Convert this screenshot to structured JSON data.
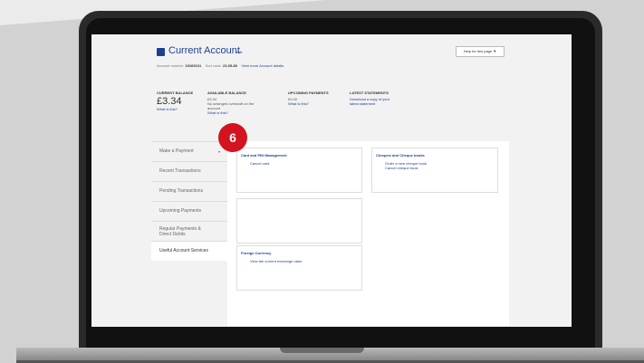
{
  "account": {
    "title": "Current Account",
    "edit_label": "edit",
    "help_label": "Help for this page ▼",
    "number_label": "Account number:",
    "number_value": "15169101",
    "sort_label": "Sort code:",
    "sort_value": "23-05-80",
    "details_link": "View more Account details"
  },
  "summary": {
    "current_balance": {
      "heading": "CURRENT BALANCE",
      "value": "£3.34",
      "link": "What is this?"
    },
    "available_balance": {
      "heading": "AVAILABLE BALANCE",
      "value": "£3.34",
      "line1": "No arranged overdraft on the",
      "line2": "account",
      "link": "What is this?"
    },
    "upcoming_payments": {
      "heading": "UPCOMING PAYMENTS",
      "value": "£0.00",
      "link": "What is this?"
    },
    "latest_statements": {
      "heading": "LATEST STATEMENTS",
      "line1": "Download a copy of your",
      "line2": "latest statement"
    }
  },
  "sidebar": {
    "items": [
      {
        "label": "Make a Payment",
        "chevron": "▾"
      },
      {
        "label": "Recent Transactions"
      },
      {
        "label": "Pending Transactions"
      },
      {
        "label": "Upcoming Payments"
      },
      {
        "label_line1": "Regular Payments &",
        "label_line2": "Direct Debits"
      },
      {
        "label": "Useful Account Services"
      }
    ]
  },
  "cards": {
    "card_pin": {
      "title": "Card and PIN Management",
      "links": [
        "Cancel card"
      ]
    },
    "cheques": {
      "title": "Cheques and Cheque books",
      "links": [
        "Order a new cheque book",
        "Cancel cheque book"
      ]
    },
    "foreign": {
      "title": "Foreign Currency",
      "links": [
        "View the current exchange rates"
      ]
    }
  },
  "badge": {
    "text": "6",
    "color": "#d3131f"
  },
  "colors": {
    "link": "#1c3f94",
    "screen_bg": "#f2f2f2"
  }
}
